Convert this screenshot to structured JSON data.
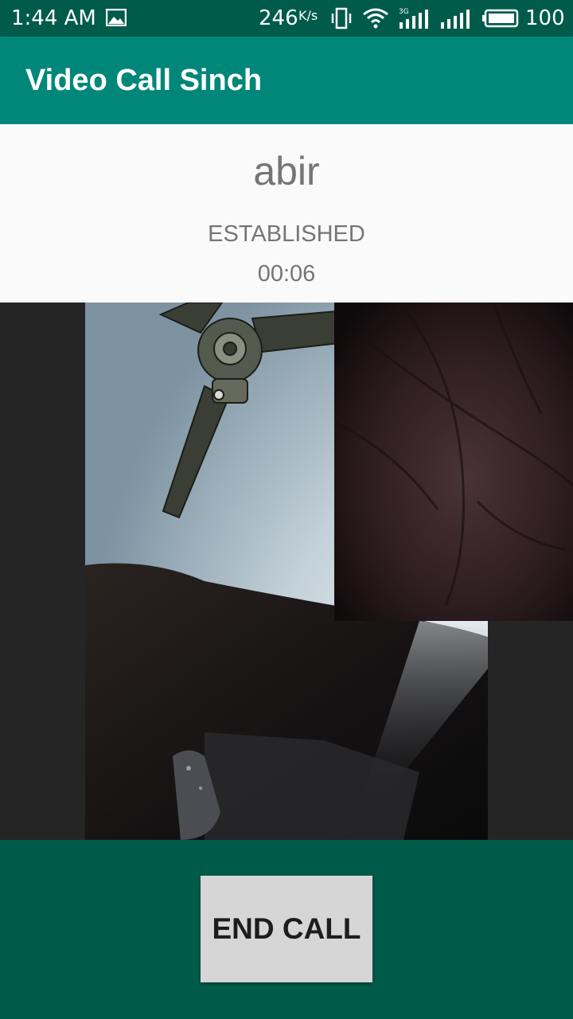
{
  "status_bar": {
    "time": "1:44 AM",
    "net_rate": "246",
    "net_unit": "K/s",
    "network_type": "3G",
    "battery": "100"
  },
  "app_bar": {
    "title": "Video Call Sinch"
  },
  "call": {
    "caller_name": "abir",
    "state": "ESTABLISHED",
    "duration": "00:06"
  },
  "controls": {
    "end_call_label": "END CALL"
  },
  "colors": {
    "status_bar": "#005b4b",
    "app_bar": "#00877a",
    "controls_bg": "#005a4a",
    "info_bg": "#fafafa",
    "info_text": "#757575",
    "button_bg": "#d6d6d6"
  }
}
